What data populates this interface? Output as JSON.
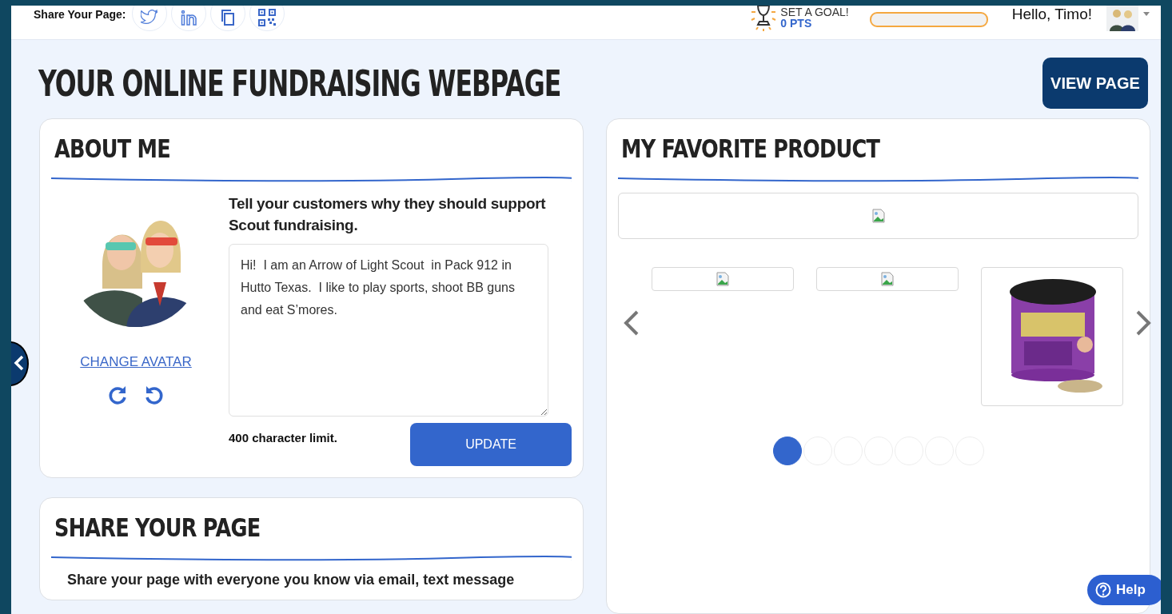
{
  "header": {
    "share_label": "Share Your Page:",
    "goal": {
      "title": "SET A GOAL!",
      "points": "0 PTS",
      "level": 0
    },
    "greeting": "Hello, Timo!"
  },
  "page_title": "YOUR ONLINE FUNDRAISING WEBPAGE",
  "view_button": "VIEW PAGE",
  "about": {
    "title": "ABOUT ME",
    "change_avatar": "CHANGE AVATAR",
    "prompt": "Tell your customers why they should support Scout fundraising.",
    "bio": "Hi!  I am an Arrow of Light Scout  in Pack 912 in Hutto Texas.  I like to play sports, shoot BB guns and eat S’mores.",
    "limit": "400 character limit.",
    "update_button": "UPDATE"
  },
  "product": {
    "title": "MY FAVORITE PRODUCT",
    "thumbnails": [
      {
        "kind": "broken"
      },
      {
        "kind": "broken"
      },
      {
        "kind": "picture"
      }
    ],
    "dots": [
      {
        "selected": true
      },
      {
        "selected": false
      },
      {
        "selected": false
      },
      {
        "selected": false
      },
      {
        "selected": false
      },
      {
        "selected": false
      },
      {
        "selected": false
      }
    ]
  },
  "share": {
    "title": "SHARE YOUR PAGE",
    "text": "Share your page with everyone you know via email, text message"
  },
  "help_button": "Help"
}
